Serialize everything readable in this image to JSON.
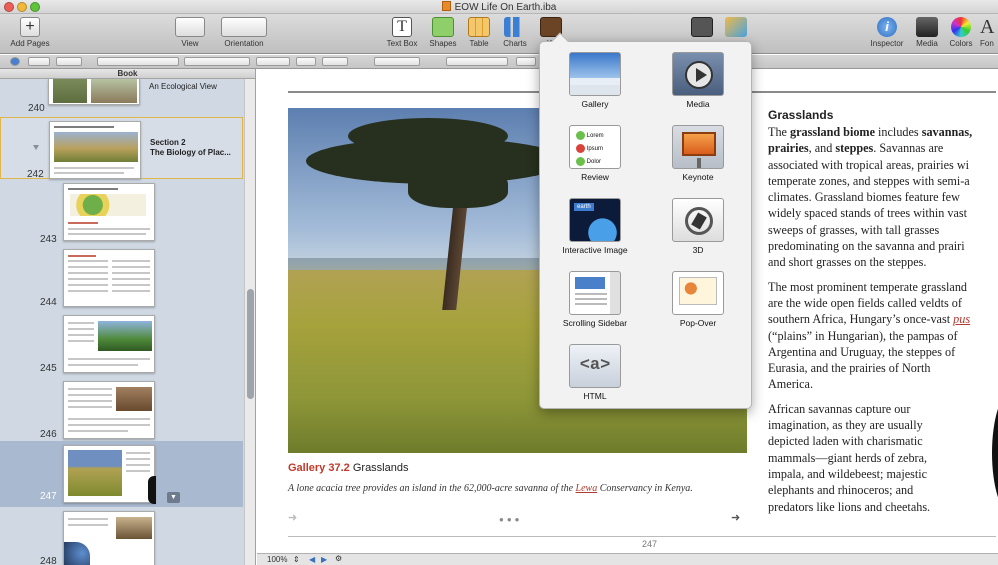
{
  "window": {
    "title": "EOW Life On Earth.iba"
  },
  "toolbar": {
    "add_pages": "Add Pages",
    "view": "View",
    "orientation": "Orientation",
    "text_box": "Text Box",
    "shapes": "Shapes",
    "table": "Table",
    "charts": "Charts",
    "widgets_partial": "W",
    "inspector": "Inspector",
    "media": "Media",
    "colors": "Colors",
    "fonts_partial": "Fon"
  },
  "sidebar": {
    "header": "Book",
    "pages": [
      {
        "num": "240",
        "label": "An Ecological View"
      },
      {
        "num": "242",
        "label": "Section 2\nThe Biology of Plac..."
      },
      {
        "num": "243"
      },
      {
        "num": "244"
      },
      {
        "num": "245"
      },
      {
        "num": "246"
      },
      {
        "num": "247"
      },
      {
        "num": "248"
      }
    ]
  },
  "page": {
    "gallery_label": "Gallery 37.2",
    "gallery_title": "Grasslands",
    "caption_pre": "A lone acacia tree provides an island in the 62,000-acre savanna of the ",
    "caption_link": "Lewa",
    "caption_post": " Conservancy in Kenya.",
    "page_number": "247",
    "heading": "Grasslands",
    "p1": [
      [
        "The ",
        "grassland biome",
        " includes ",
        "savannas,"
      ],
      [
        "",
        "prairies",
        ", and ",
        "steppes",
        ". Savannas are"
      ],
      [
        "associated with tropical areas, prairies wi"
      ],
      [
        "temperate zones, and steppes with semi-a"
      ],
      [
        "climates. Grassland biomes feature few"
      ],
      [
        "widely spaced stands of trees within vast"
      ],
      [
        "sweeps of grasses, with tall grasses"
      ],
      [
        "predominating on the savanna and prairi"
      ],
      [
        "and short grasses on the steppes."
      ]
    ],
    "p2_lines": [
      "The most prominent temperate grassland",
      "are the wide open fields called veldts of",
      "southern Africa, Hungary’s once-vast ",
      "(“plains” in Hungarian), the pampas of",
      "Argentina and Uruguay, the steppes of",
      "Eurasia, and the prairies of North",
      "America."
    ],
    "p2_link": "pus",
    "p3_lines": [
      "African savannas capture our",
      "imagination, as they are usually",
      "depicted laden with charismatic",
      "mammals—giant herds of zebra,",
      "impala, and wildebeest; majestic",
      "elephants and rhinoceros; and",
      "predators like lions and cheetahs."
    ]
  },
  "widgets_menu": {
    "items": [
      "Gallery",
      "Media",
      "Review",
      "Keynote",
      "Interactive Image",
      "3D",
      "Scrolling Sidebar",
      "Pop-Over",
      "HTML"
    ],
    "review_options": [
      "Lorem",
      "Ipsum",
      "Dolor"
    ],
    "interactive_tag": "earth",
    "html_glyph": "<a>"
  },
  "status": {
    "zoom": "100%"
  },
  "colors": {
    "accent_red": "#c0392b",
    "sidebar_bg": "#cfd8e3",
    "selected_row": "#a9b9cf"
  }
}
